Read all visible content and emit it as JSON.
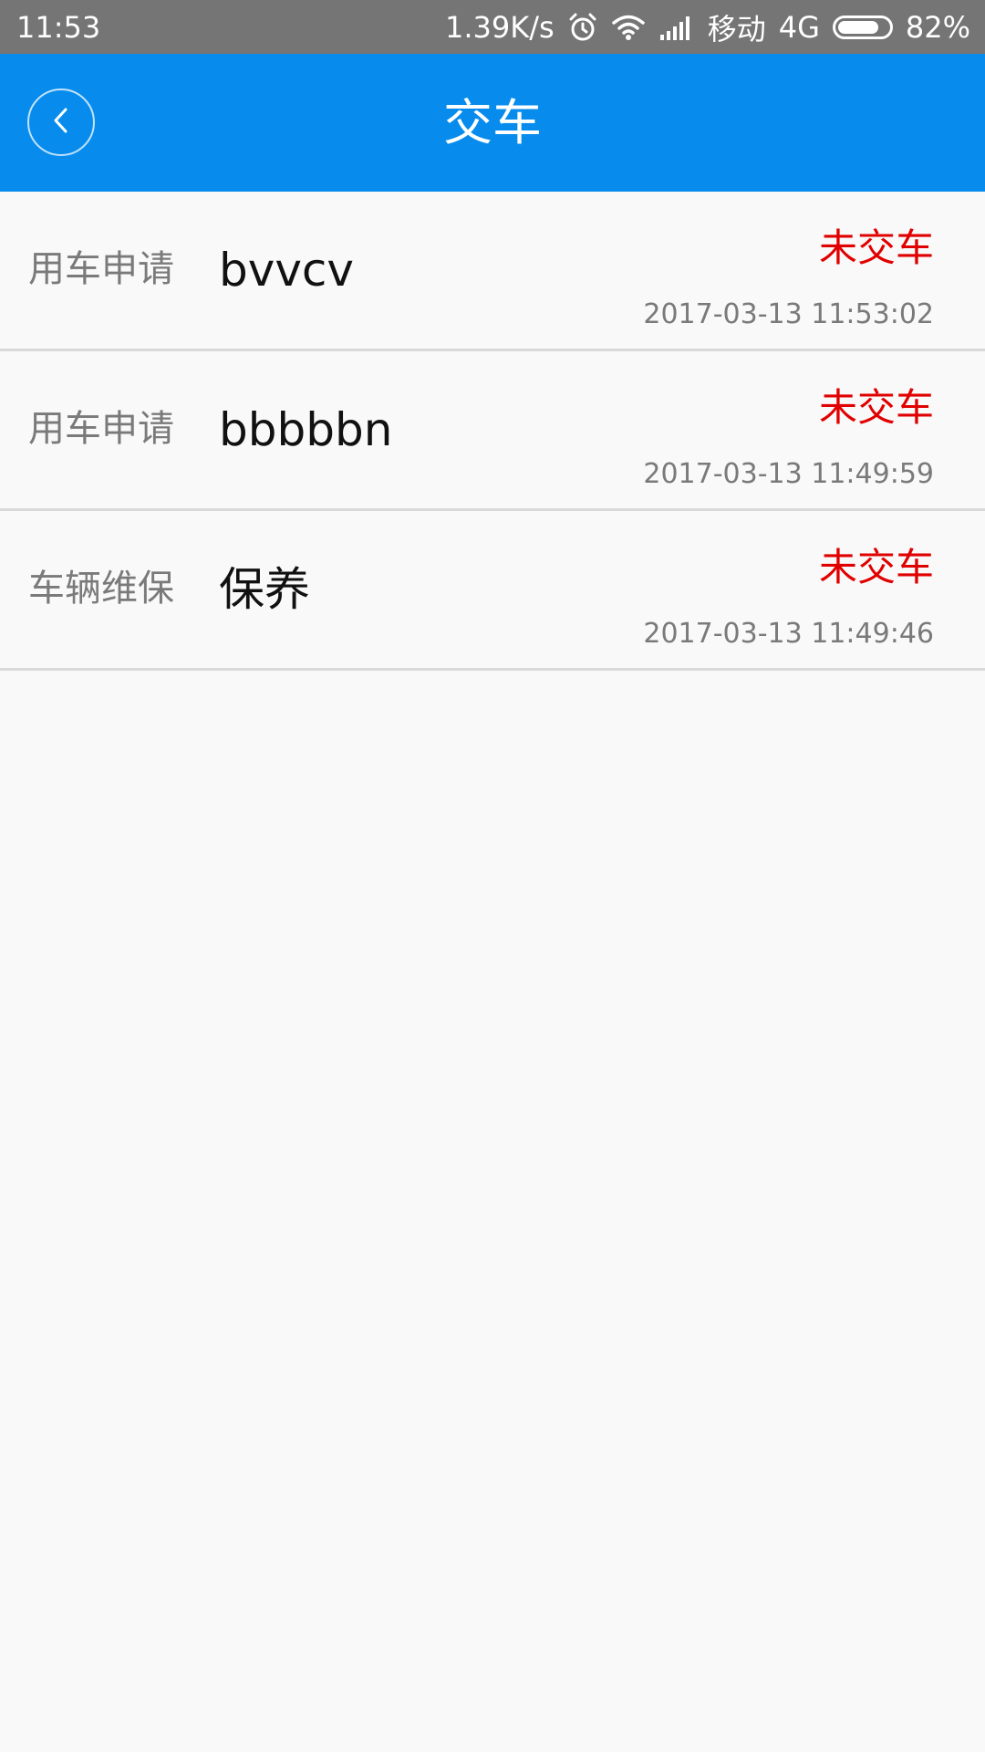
{
  "status_bar": {
    "time": "11:53",
    "net_speed": "1.39K/s",
    "carrier": "移动",
    "network": "4G",
    "battery_percent": "82%",
    "battery_level": 0.82,
    "icons": [
      "alarm-icon",
      "wifi-icon",
      "signal-icon",
      "battery-icon"
    ]
  },
  "header": {
    "title": "交车",
    "back_icon": "chevron-left-icon",
    "background_color": "#078ced"
  },
  "items": [
    {
      "type": "用车申请",
      "name": "bvvcv",
      "status": "未交车",
      "time": "2017-03-13 11:53:02"
    },
    {
      "type": "用车申请",
      "name": "bbbbbn",
      "status": "未交车",
      "time": "2017-03-13 11:49:59"
    },
    {
      "type": "车辆维保",
      "name": "保养",
      "status": "未交车",
      "time": "2017-03-13 11:49:46"
    }
  ],
  "colors": {
    "status_text": "#e10000",
    "page_background": "#f9f9f9"
  }
}
